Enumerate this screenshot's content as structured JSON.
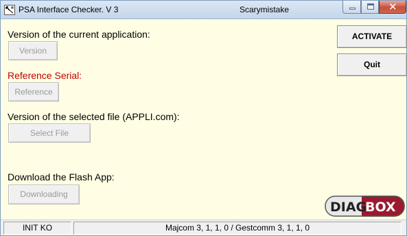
{
  "window": {
    "title": "PSA Interface Checker. V 3",
    "user": "Scarymistake"
  },
  "sections": {
    "version_label": "Version of the current application:",
    "version_button": "Version",
    "reference_label": "Reference Serial:",
    "reference_button": "Reference",
    "file_label": "Version of the selected file (APPLI.com):",
    "file_button": "Select File",
    "flash_label": "Download the Flash App:",
    "flash_button": "Downloading"
  },
  "actions": {
    "activate": "ACTIVATE",
    "quit": "Quit"
  },
  "logo": {
    "part1": "DIAG",
    "part2": "BOX"
  },
  "status": {
    "left": "INIT KO",
    "right": "Majcom 3, 1, 1, 0 / Gestcomm 3, 1, 1, 0"
  },
  "colors": {
    "background": "#fffee4",
    "reference_label": "#c00000",
    "logo_accent": "#9b1a2e"
  }
}
